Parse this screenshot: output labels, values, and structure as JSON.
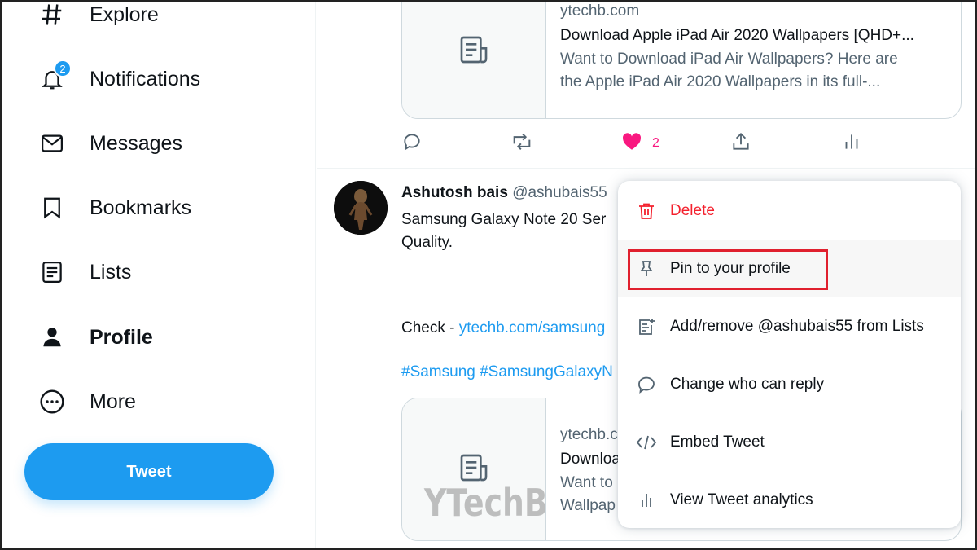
{
  "sidebar": {
    "items": [
      {
        "label": "Explore",
        "icon": "hashtag-icon"
      },
      {
        "label": "Notifications",
        "icon": "bell-icon",
        "badge": "2"
      },
      {
        "label": "Messages",
        "icon": "envelope-icon"
      },
      {
        "label": "Bookmarks",
        "icon": "bookmark-icon"
      },
      {
        "label": "Lists",
        "icon": "list-icon"
      },
      {
        "label": "Profile",
        "icon": "person-icon",
        "active": true
      },
      {
        "label": "More",
        "icon": "more-circle-icon"
      }
    ],
    "tweet_button": "Tweet"
  },
  "feed": {
    "first_card": {
      "domain": "ytechb.com",
      "title": "Download Apple iPad Air 2020 Wallpapers [QHD+...",
      "desc_line1": "Want to Download iPad Air Wallpapers? Here are",
      "desc_line2": "the Apple iPad Air 2020 Wallpapers in its full-..."
    },
    "actions": {
      "like_count": "2"
    },
    "tweet": {
      "name": "Ashutosh bais",
      "handle": "@ashubais55",
      "text_line1": "Samsung Galaxy Note 20 Ser",
      "text_line2": "Quality.",
      "check_prefix": "Check - ",
      "check_link": "ytechb.com/samsung",
      "hashtags": "#Samsung #SamsungGalaxyN",
      "card": {
        "domain": "ytechb.co",
        "title": "Downloa",
        "desc_line1": "Want to",
        "desc_line2": "Wallpap"
      }
    }
  },
  "menu": {
    "items": [
      {
        "label": "Delete",
        "icon": "trash-icon"
      },
      {
        "label": "Pin to your profile",
        "icon": "pin-icon"
      },
      {
        "label": "Add/remove @ashubais55 from Lists",
        "icon": "list-add-icon"
      },
      {
        "label": "Change who can reply",
        "icon": "reply-bubble-icon"
      },
      {
        "label": "Embed Tweet",
        "icon": "code-icon"
      },
      {
        "label": "View Tweet analytics",
        "icon": "analytics-icon"
      }
    ]
  },
  "watermark": "YTechB",
  "colors": {
    "accent": "#1d9bf0",
    "danger": "#f4212e",
    "like": "#f91880",
    "highlight": "#e0202e"
  }
}
